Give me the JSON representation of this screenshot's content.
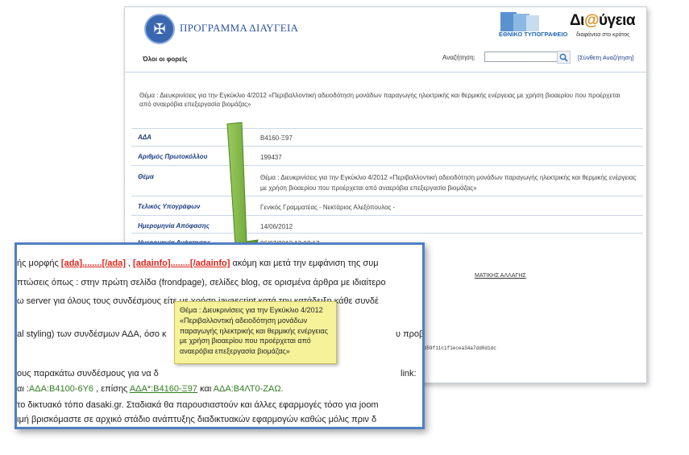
{
  "header": {
    "program_title": "ΠΡΟΓΡΑΜΜΑ ΔΙΑΥΓΕΙΑ",
    "et_label": "ΕΘΝΙΚΟ ΤΥΠΟΓΡΑΦΕΙΟ",
    "logo_pre": "Δι",
    "logo_at": "@",
    "logo_post": "ύγεια",
    "logo_sub": "διαφάνεια στο κράτος"
  },
  "toolbar": {
    "all_agencies": "Όλοι οι φορείς",
    "search_label": "Αναζήτηση:",
    "search_value": "",
    "advanced_search": "[Σύνθετη Αναζήτηση]"
  },
  "decision": {
    "subject_heading": "Θέμα : Διευκρινίσεις για την Εγκύκλιο 4/2012 «Περιβαλλοντική αδειοδότηση μονάδων παραγωγής ηλεκτρικής και θερμικής ενέργειας με χρήση βιοαερίου που προέρχεται από αναερόβια επεξεργασία βιομάζας»",
    "rows": [
      {
        "label": "ΑΔΑ",
        "value": "Β4160-Ξ97"
      },
      {
        "label": "Αριθμός Πρωτοκόλλου",
        "value": "199437"
      },
      {
        "label": "Θέμα",
        "value": "Θέμα : Διευκρινίσεις για την Εγκύκλιο 4/2012 «Περιβαλλοντική αδειοδότηση μονάδων παραγωγής ηλεκτρικής και θερμικής ενέργειας με χρήση βιοαερίου που προέρχεται από αναερόβια επεξεργασία βιομάζας»"
      },
      {
        "label": "Τελικός Υπογράφων",
        "value": "Γενικός Γραμματέας - Νεκτάριος Αλεξόπουλος -"
      },
      {
        "label": "Ημερομηνία Απόφασης",
        "value": "14/06/2012"
      },
      {
        "label": "Ημερομηνία Ανάρτησης",
        "value": "06/07/2012 13:03:17"
      }
    ],
    "partial_link": "ΜΑΤΙΚΗΣ ΑΛΛΑΓΗΣ",
    "partial_hash": "f7dd59f11c1f1ecea34a7dd0d1dc"
  },
  "zoom": {
    "line1_pre": "ής μορφής ",
    "line1_tag1": "[ada]........[/ada]",
    "line1_mid": " , ",
    "line1_tag2": "[adainfo]........[/adainfo]",
    "line1_post": " ακόμη και μετά την εμφάνιση της συμ",
    "line2": "πτώσεις όπως : στην πρώτη σελίδα (frondpage), σελίδες blog, σε ορισμένα άρθρα με ιδιαίτερο",
    "line3": "ω server για όλους τους συνδέσμους είτε με χρήση javascript κατά την κατάδειξη κάθε συνδέ",
    "line4": "al styling) των συνδέσμων ΑΔΑ, όσο κ",
    "line4_end": "υ προβ",
    "line5": "ους παρακάτω συνδέσμους για να δ",
    "line5_end": "link:",
    "line6_pre": "αι :",
    "line6_l1": "ΑΔΑ:Β4100-6Υ6",
    "line6_mid": " , επίσης ",
    "line6_l2": "ΑΔΑ*:Β4160-Ξ97",
    "line6_and": " και ",
    "line6_l3": "ΑΔΑ:Β4ΛΤ0-ΖΑΩ.",
    "line7": "το δικτυακό τόπο dasaki.gr. Σταδιακά θα παρουσιαστούν και άλλες εφαρμογές τόσο για joom",
    "line8": "ιμή βρισκόμαστε σε αρχικό στάδιο ανάπτυξης διαδικτυακών εφαρμογών καθώς μόλις πριν δ"
  },
  "tooltip": {
    "lines": [
      "Θέμα : Διευκρινίσεις για την Εγκύκλιο 4/2012",
      "«Περιβαλλοντική αδειοδότηση μονάδων",
      "παραγωγής ηλεκτρικής και θερμικής ενέργειας",
      "με χρήση βιοαερίου που προέρχεται από",
      "αναερόβια επεξεργασία βιομάζας»"
    ]
  },
  "colors": {
    "accent": "#2c53a2",
    "frame": "#4f7fc4",
    "arrow": "#7ab342",
    "tag_red": "#e0251b",
    "link_green": "#2f7d1f",
    "tooltip_bg": "#f6f29a"
  }
}
